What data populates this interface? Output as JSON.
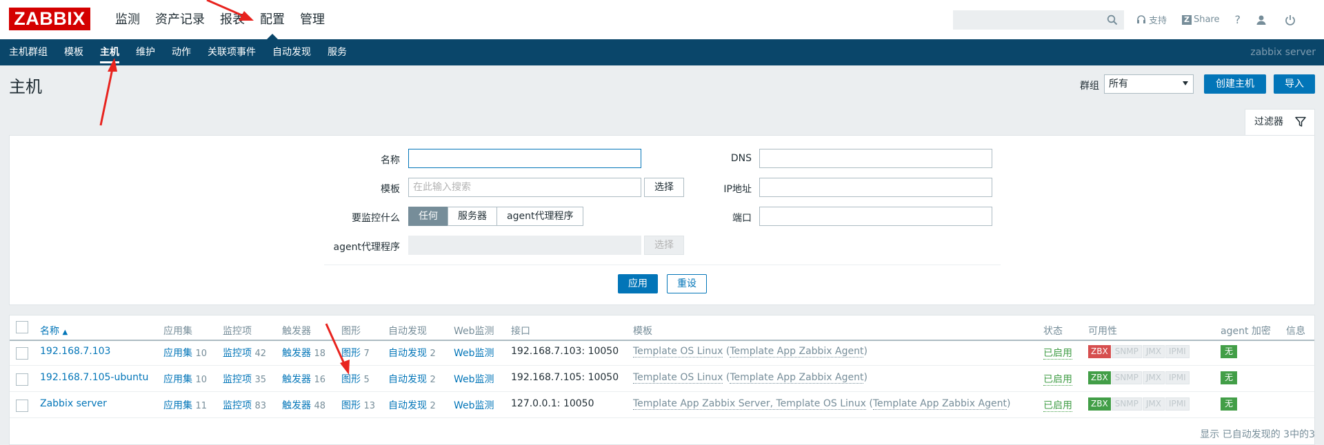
{
  "topbar": {
    "logo": "ZABBIX",
    "menu": [
      "监测",
      "资产记录",
      "报表",
      "配置",
      "管理"
    ],
    "links": {
      "support": "支持",
      "share": "Share",
      "help": "?"
    }
  },
  "subbar": {
    "menu": [
      "主机群组",
      "模板",
      "主机",
      "维护",
      "动作",
      "关联项事件",
      "自动发现",
      "服务"
    ],
    "server": "zabbix server"
  },
  "header": {
    "title": "主机",
    "group_label": "群组",
    "group_value": "所有",
    "create_button": "创建主机",
    "import_button": "导入"
  },
  "filter": {
    "tab_label": "过滤器",
    "name_label": "名称",
    "name_value": "",
    "template_label": "模板",
    "template_placeholder": "在此输入搜索",
    "select_button": "选择",
    "monitor_label": "要监控什么",
    "monitor_options": [
      "任何",
      "服务器",
      "agent代理程序"
    ],
    "proxy_label": "agent代理程序",
    "proxy_select_button": "选择",
    "dns_label": "DNS",
    "ip_label": "IP地址",
    "port_label": "端口",
    "apply_button": "应用",
    "reset_button": "重设"
  },
  "table": {
    "headers": {
      "name": "名称",
      "applications": "应用集",
      "items": "监控项",
      "triggers": "触发器",
      "graphs": "图形",
      "discovery": "自动发现",
      "web": "Web监测",
      "interface": "接口",
      "templates": "模板",
      "status": "状态",
      "availability": "可用性",
      "encryption": "agent 加密",
      "info": "信息"
    },
    "rows": [
      {
        "name": "192.168.7.103",
        "app_label": "应用集",
        "app_count": "10",
        "items_label": "监控项",
        "items_count": "42",
        "triggers_label": "触发器",
        "triggers_count": "18",
        "graphs_label": "图形",
        "graphs_count": "7",
        "discovery_label": "自动发现",
        "discovery_count": "2",
        "web_label": "Web监测",
        "interface": "192.168.7.103: 10050",
        "tpl_main": "Template OS Linux",
        "tpl_open": " (",
        "tpl_parent": "Template App Zabbix Agent",
        "tpl_close": ")",
        "status": "已启用",
        "zbx_color": "red",
        "encryption": "无"
      },
      {
        "name": "192.168.7.105-ubuntu",
        "app_label": "应用集",
        "app_count": "10",
        "items_label": "监控项",
        "items_count": "35",
        "triggers_label": "触发器",
        "triggers_count": "16",
        "graphs_label": "图形",
        "graphs_count": "5",
        "discovery_label": "自动发现",
        "discovery_count": "2",
        "web_label": "Web监测",
        "interface": "192.168.7.105: 10050",
        "tpl_main": "Template OS Linux",
        "tpl_open": " (",
        "tpl_parent": "Template App Zabbix Agent",
        "tpl_close": ")",
        "status": "已启用",
        "zbx_color": "green",
        "encryption": "无"
      },
      {
        "name": "Zabbix server",
        "app_label": "应用集",
        "app_count": "11",
        "items_label": "监控项",
        "items_count": "83",
        "triggers_label": "触发器",
        "triggers_count": "48",
        "graphs_label": "图形",
        "graphs_count": "13",
        "discovery_label": "自动发现",
        "discovery_count": "2",
        "web_label": "Web监测",
        "interface": "127.0.0.1: 10050",
        "tpl_main": "Template App Zabbix Server, Template OS Linux",
        "tpl_open": " (",
        "tpl_parent": "Template App Zabbix Agent",
        "tpl_close": ")",
        "status": "已启用",
        "zbx_color": "green",
        "encryption": "无"
      }
    ],
    "availability_badges": [
      "ZBX",
      "SNMP",
      "JMX",
      "IPMI"
    ],
    "footer": "显示 已自动发现的 3中的3"
  },
  "colors": {
    "brand": "#d40000",
    "nav": "#0a466a",
    "link": "#0275b8",
    "enabled": "#429e47",
    "unavailable": "#d64e4e",
    "annotation": "#e8231e"
  }
}
